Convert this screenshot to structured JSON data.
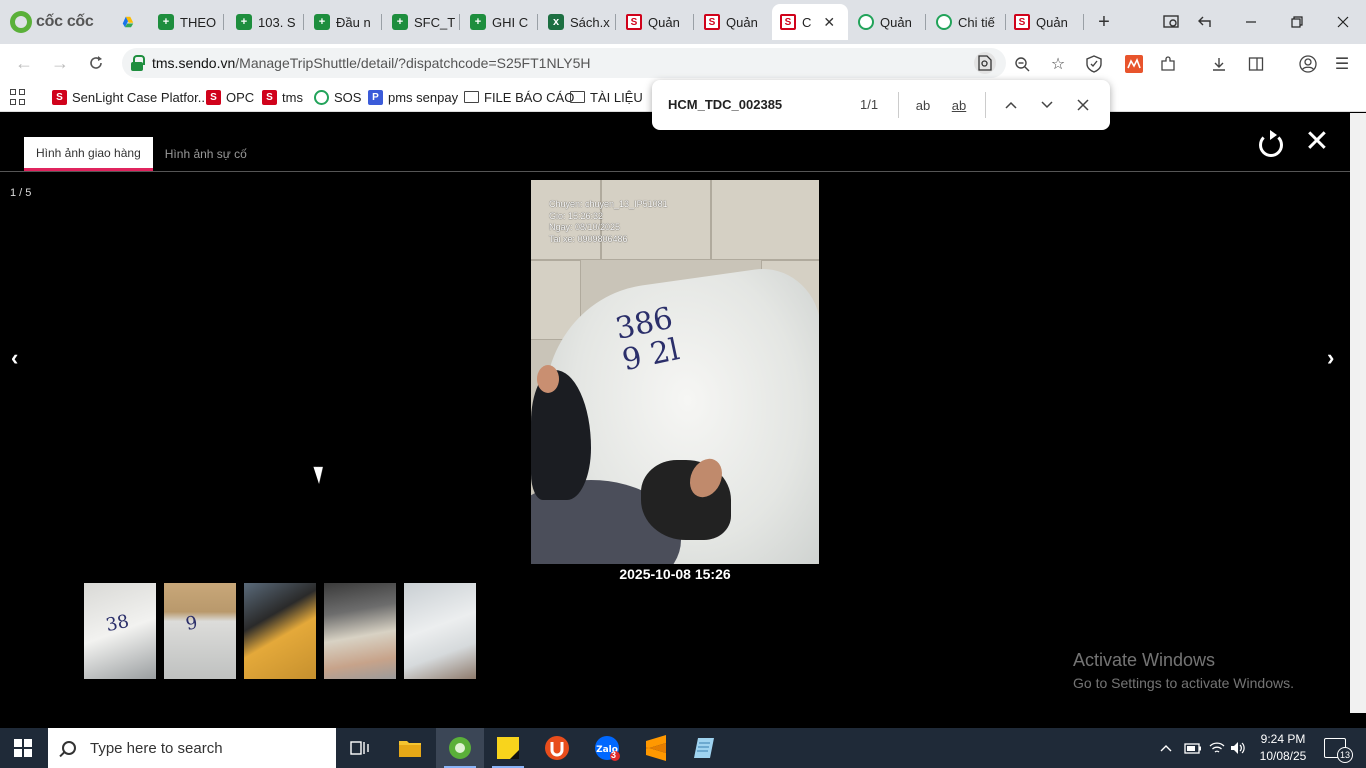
{
  "browser": {
    "brand": "cốc cốc",
    "tabs": [
      {
        "label": "THEO",
        "icon": "sheets-icon"
      },
      {
        "label": "103. S",
        "icon": "sheets-icon"
      },
      {
        "label": "Đầu n",
        "icon": "sheets-icon"
      },
      {
        "label": "SFC_T",
        "icon": "sheets-icon"
      },
      {
        "label": "GHI C",
        "icon": "sheets-icon"
      },
      {
        "label": "Sách.x",
        "icon": "excel-icon"
      },
      {
        "label": "Quản",
        "icon": "sendo-icon"
      },
      {
        "label": "Quản",
        "icon": "sendo-icon"
      },
      {
        "label": "C",
        "icon": "sendo-icon",
        "active": true
      },
      {
        "label": "Quản",
        "icon": "green-icon"
      },
      {
        "label": "Chi tiế",
        "icon": "green-icon"
      },
      {
        "label": "Quản",
        "icon": "sendo-icon"
      }
    ],
    "url_host": "tms.sendo.vn",
    "url_path": "/ManageTripShuttle/detail/?dispatchcode=S25FT1NLY5H",
    "bookmarks": [
      {
        "label": "SenLight Case Platfor...",
        "icon": "sendo"
      },
      {
        "label": "OPC",
        "icon": "sendo"
      },
      {
        "label": "tms",
        "icon": "sendo"
      },
      {
        "label": "SOS",
        "icon": "sos"
      },
      {
        "label": "pms senpay",
        "icon": "pms"
      },
      {
        "label": "FILE BÁO CÁO",
        "icon": "folder"
      },
      {
        "label": "TÀI LIỆU",
        "icon": "folder"
      }
    ]
  },
  "findbar": {
    "query": "HCM_TDC_002385",
    "count": "1/1",
    "match_case_label": "ab",
    "whole_word_label": "ab"
  },
  "viewer": {
    "tabs": [
      "Hình ảnh giao hàng",
      "Hình ảnh sự cố"
    ],
    "counter": "1 / 5",
    "prev": "‹",
    "next": "›",
    "close": "✕",
    "photo_stamp": [
      "Chuyen: chuyen_13_IP51081",
      "Gio: 15:26:32",
      "Ngay: 08/10/2025",
      "Tai xe: 0909806486"
    ],
    "photo_writing": "386\n9 2l",
    "timestamp": "2025-10-08 15:26",
    "thumbnail_count": 5
  },
  "watermark": {
    "title": "Activate Windows",
    "subtitle": "Go to Settings to activate Windows."
  },
  "taskbar": {
    "search_placeholder": "Type here to search",
    "time": "9:24 PM",
    "date": "10/08/25",
    "notification_count": "13",
    "zalo_badge": "3"
  }
}
